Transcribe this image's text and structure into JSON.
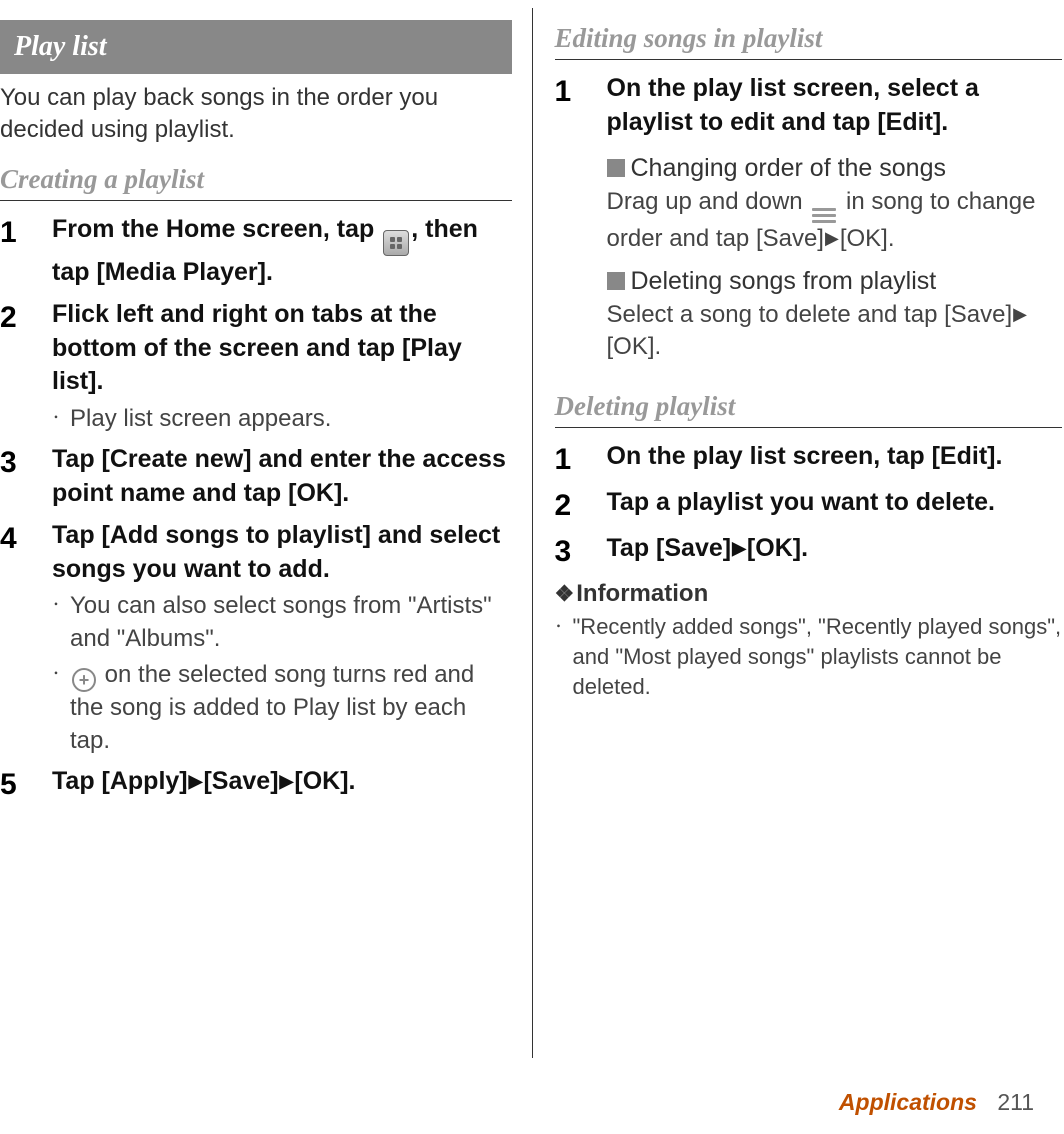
{
  "left": {
    "section_title": "Play list",
    "intro": "You can play back songs in the order you decided using playlist.",
    "sub1": "Creating a playlist",
    "steps": [
      {
        "n": "1",
        "title_a": "From the Home screen, tap ",
        "title_b": ", then tap [Media Player].",
        "icon": "apps-grid"
      },
      {
        "n": "2",
        "title": "Flick left and right on tabs at the bottom of the screen and tap [Play list].",
        "bullets": [
          {
            "text": "Play list screen appears."
          }
        ]
      },
      {
        "n": "3",
        "title": "Tap [Create new] and enter the access point name and tap [OK]."
      },
      {
        "n": "4",
        "title": "Tap [Add songs to playlist] and select songs you want to add.",
        "bullets": [
          {
            "text": "You can also select songs from \"Artists\" and \"Albums\"."
          },
          {
            "icon": "circle-plus",
            "text": " on the selected song turns red and the song is added to Play list by each tap."
          }
        ]
      },
      {
        "n": "5",
        "title_parts": [
          "Tap [Apply]",
          "[Save]",
          "[OK]."
        ]
      }
    ]
  },
  "right": {
    "sub1": "Editing songs in playlist",
    "steps1": [
      {
        "n": "1",
        "title": "On the play list screen, select a playlist to edit and tap [Edit].",
        "subsections": [
          {
            "heading": "Changing order of the songs",
            "body_a": "Drag up and down ",
            "body_b": " in song to change order and tap [Save]",
            "body_c": "[OK].",
            "icon": "drag-handles"
          },
          {
            "heading": "Deleting songs from playlist",
            "body_a": "Select a song to delete and tap [Save]",
            "body_c": "[OK]."
          }
        ]
      }
    ],
    "sub2": "Deleting playlist",
    "steps2": [
      {
        "n": "1",
        "title": "On the play list screen, tap [Edit]."
      },
      {
        "n": "2",
        "title": "Tap a playlist you want to delete."
      },
      {
        "n": "3",
        "title_parts": [
          "Tap [Save]",
          "[OK]."
        ]
      }
    ],
    "info_heading": "Information",
    "info_bullet": "\"Recently added songs\", \"Recently played songs\", and \"Most played songs\" playlists cannot be deleted."
  },
  "footer": {
    "label": "Applications",
    "page": "211"
  }
}
